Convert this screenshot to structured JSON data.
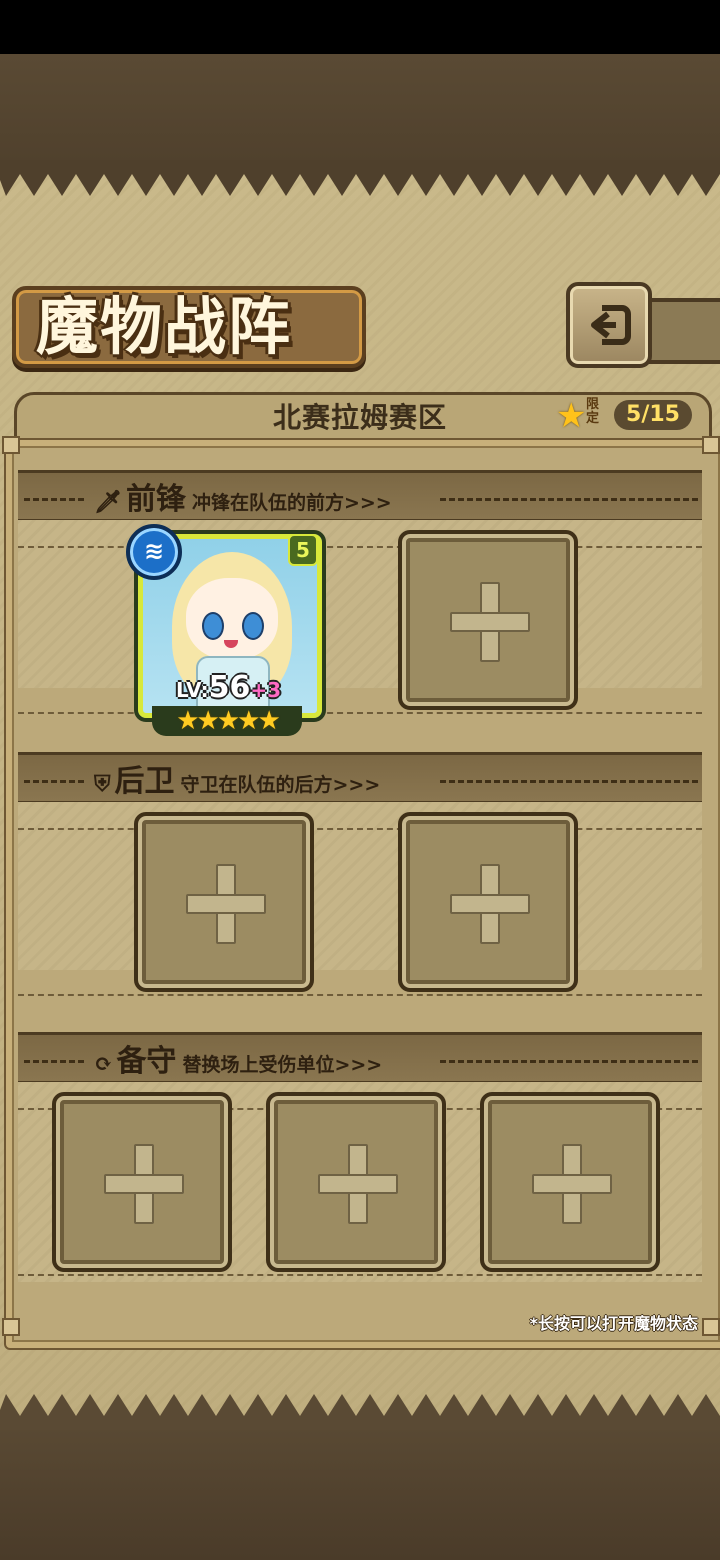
{
  "title": "魔物战阵",
  "region": {
    "name": "北赛拉姆赛区",
    "limit_tag": "限定",
    "count": "5/15"
  },
  "sections": {
    "front": {
      "title": "前锋",
      "desc": "冲锋在队伍的前方>>>"
    },
    "back": {
      "title": "后卫",
      "desc": "守卫在队伍的后方>>>"
    },
    "reserve": {
      "title": "备守",
      "desc": "替换场上受伤单位>>>"
    }
  },
  "character": {
    "level_prefix": "LV:",
    "level": "56",
    "bonus": "+3",
    "rank": "5",
    "stars": "★★★★★",
    "star_count": 5,
    "element_icon": "water-element-icon"
  },
  "hint": "*长按可以打开魔物状态",
  "colors": {
    "parchment": "#c6b588",
    "frame": "#c8b07a",
    "accent_yellow": "#d8e83a",
    "count_text": "#ffe066"
  }
}
